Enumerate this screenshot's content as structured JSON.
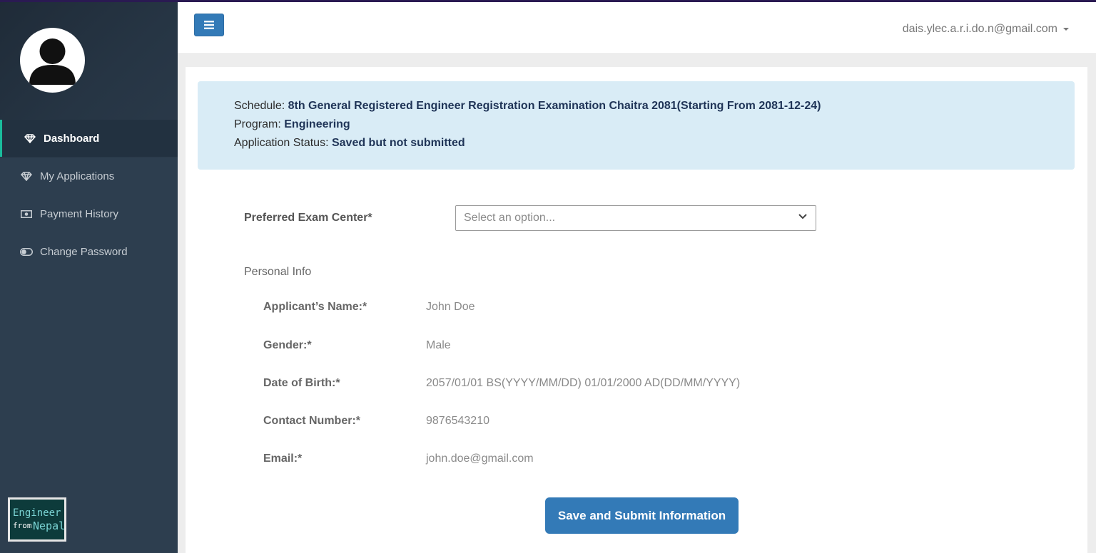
{
  "sidebar": {
    "items": [
      {
        "label": "Dashboard",
        "icon": "diamond-icon",
        "active": true
      },
      {
        "label": "My Applications",
        "icon": "diamond-icon"
      },
      {
        "label": "Payment History",
        "icon": "money-icon"
      },
      {
        "label": "Change Password",
        "icon": "toggle-icon"
      }
    ],
    "logo": {
      "line1": "Engineer",
      "from": "from",
      "line2": "Nepal"
    }
  },
  "header": {
    "user_email": "dais.ylec.a.r.i.do.n@gmail.com"
  },
  "alert": {
    "schedule_label": "Schedule: ",
    "schedule_value": "8th General Registered Engineer Registration Examination Chaitra 2081(Starting From 2081-12-24)",
    "program_label": "Program: ",
    "program_value": "Engineering",
    "status_label": "Application Status: ",
    "status_value": "Saved but not submitted"
  },
  "form": {
    "exam_center_label": "Preferred Exam Center*",
    "exam_center_placeholder": "Select an option...",
    "section_title": "Personal Info",
    "rows": [
      {
        "label": "Applicant’s Name:*",
        "value": "John Doe"
      },
      {
        "label": "Gender:*",
        "value": "Male"
      },
      {
        "label": "Date of Birth:*",
        "value": "2057/01/01 BS(YYYY/MM/DD) 01/01/2000 AD(DD/MM/YYYY)"
      },
      {
        "label": "Contact Number:*",
        "value": "9876543210"
      },
      {
        "label": "Email:*",
        "value": "john.doe@gmail.com"
      }
    ],
    "submit_label": "Save and Submit Information"
  },
  "colors": {
    "sidebar_bg": "#2d3e4f",
    "accent": "#1abc9c",
    "primary_button": "#337ab7",
    "alert_bg": "#d9ecf6"
  }
}
